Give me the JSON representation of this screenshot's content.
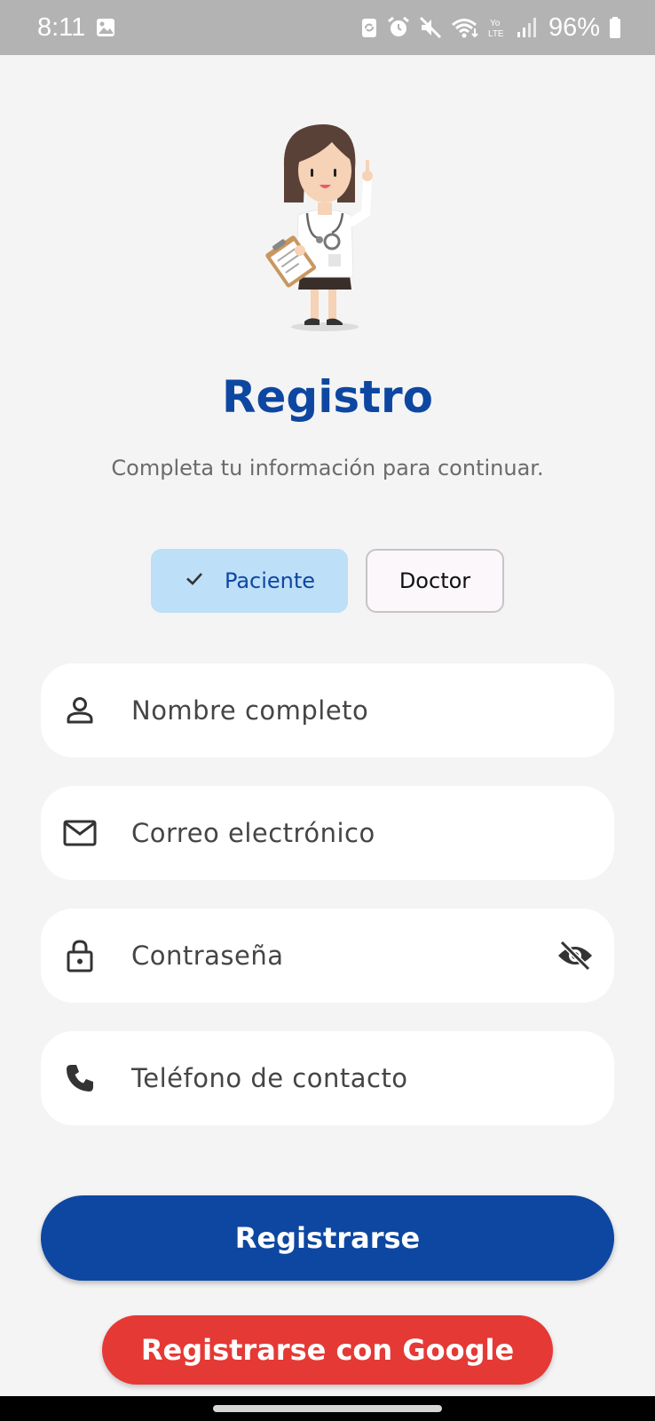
{
  "status_bar": {
    "time": "8:11",
    "battery": "96%",
    "icons": [
      "gallery-icon",
      "sync-icon",
      "alarm-icon",
      "mute-icon",
      "wifi-icon",
      "volte-icon",
      "signal-icon",
      "battery-icon"
    ]
  },
  "header": {
    "title": "Registro",
    "subtitle": "Completa tu información para continuar."
  },
  "role_selector": {
    "options": [
      {
        "label": "Paciente",
        "selected": true
      },
      {
        "label": "Doctor",
        "selected": false
      }
    ]
  },
  "form": {
    "name_placeholder": "Nombre completo",
    "email_placeholder": "Correo electrónico",
    "password_placeholder": "Contraseña",
    "phone_placeholder": "Teléfono de contacto"
  },
  "actions": {
    "register_label": "Registrarse",
    "google_label": "Registrarse con Google"
  },
  "colors": {
    "primary": "#0d47a1",
    "google": "#e53935",
    "selected_chip": "#bedff8",
    "background": "#f4f4f4"
  }
}
